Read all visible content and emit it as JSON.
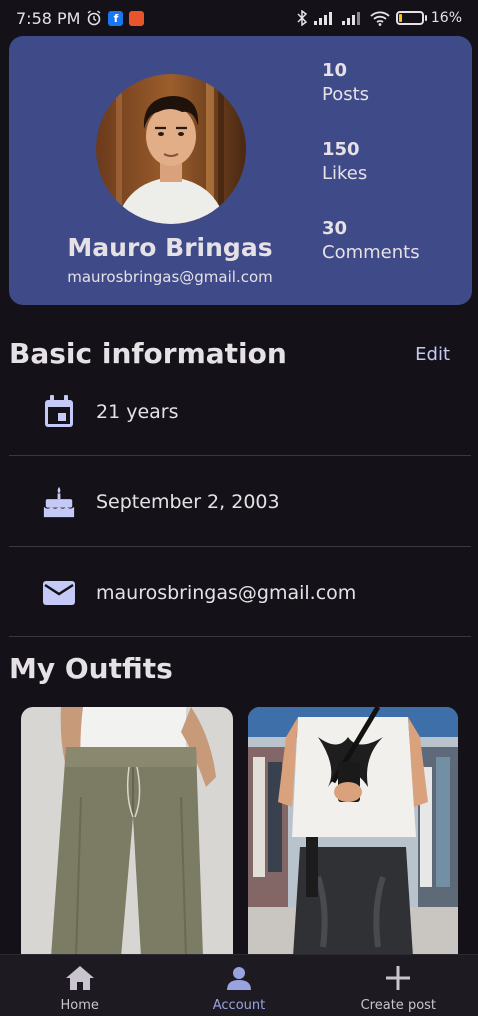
{
  "status_bar": {
    "time": "7:58 PM",
    "battery_percent": "16%",
    "battery_level": 0.16,
    "icons": [
      "alarm-icon",
      "facebook-icon",
      "recorder-icon",
      "bluetooth-icon",
      "signal-icon",
      "signal-icon",
      "wifi-icon",
      "battery-icon"
    ]
  },
  "profile": {
    "name": "Mauro Bringas",
    "email": "maurosbringas@gmail.com",
    "stats": [
      {
        "value": "10",
        "label": "Posts"
      },
      {
        "value": "150",
        "label": "Likes"
      },
      {
        "value": "30",
        "label": "Comments"
      }
    ]
  },
  "basic_info": {
    "title": "Basic information",
    "edit_label": "Edit",
    "rows": [
      {
        "icon": "calendar-icon",
        "text": "21 years"
      },
      {
        "icon": "cake-icon",
        "text": "September 2, 2003"
      },
      {
        "icon": "mail-icon",
        "text": "maurosbringas@gmail.com"
      }
    ]
  },
  "outfits": {
    "title": "My Outfits",
    "items": [
      {
        "image": "outfit-photo-1"
      },
      {
        "image": "outfit-photo-2"
      }
    ]
  },
  "bottom_nav": {
    "items": [
      {
        "label": "Home",
        "icon": "home-icon"
      },
      {
        "label": "Account",
        "icon": "account-icon",
        "active": true
      },
      {
        "label": "Create post",
        "icon": "plus-icon"
      }
    ]
  },
  "colors": {
    "background": "#141218",
    "card": "#3F4A89",
    "accent": "#C5C9F5",
    "text": "#E6E1E5"
  }
}
